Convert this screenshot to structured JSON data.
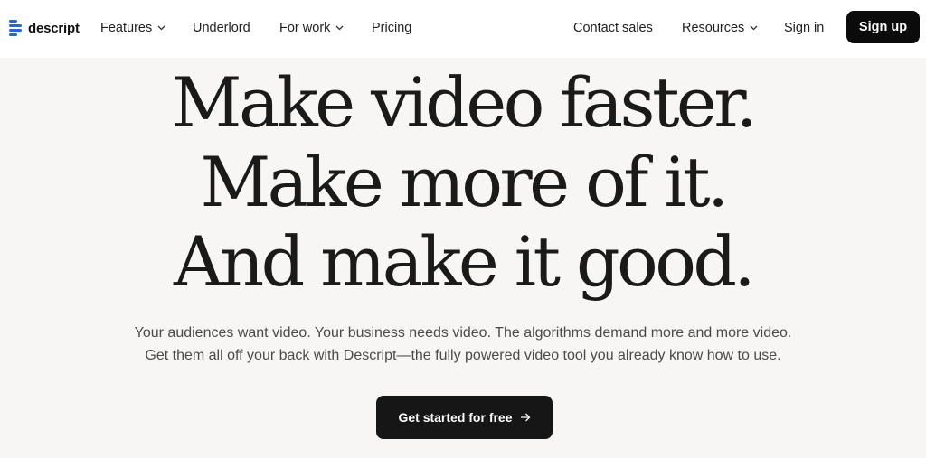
{
  "brand": {
    "name": "descript",
    "logo_icon": "descript-logo-icon"
  },
  "nav": {
    "features": "Features",
    "underlord": "Underlord",
    "for_work": "For work",
    "pricing": "Pricing",
    "contact_sales": "Contact sales",
    "resources": "Resources",
    "sign_in": "Sign in",
    "sign_up": "Sign up"
  },
  "hero": {
    "line1": "Make video faster.",
    "line2": "Make more of it.",
    "line3": "And make it good.",
    "sub_line1": "Your audiences want video. Your business needs video. The algorithms demand more and more video.",
    "sub_line2": "Get them all off your back with Descript—the fully powered video tool you already know how to use.",
    "cta": "Get started for free"
  },
  "colors": {
    "background": "#f7f6f4",
    "header": "#ffffff",
    "button": "#0b0b0b",
    "logo_blue": "#2563eb"
  }
}
